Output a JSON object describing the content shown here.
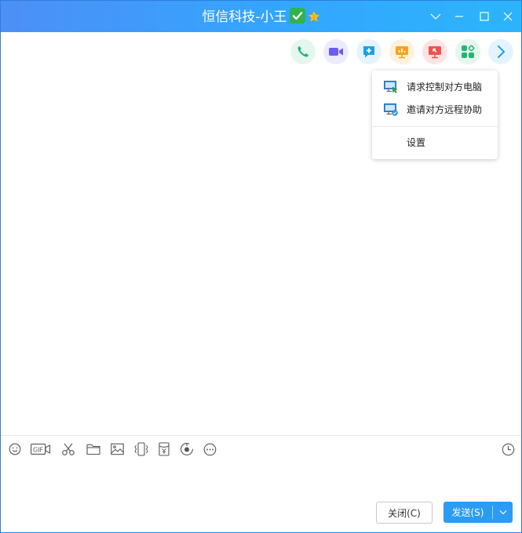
{
  "window": {
    "title": "恒信科技-小王"
  },
  "toolbar": {
    "icons": [
      "phone-icon",
      "video-call-icon",
      "new-chat-icon",
      "presentation-icon",
      "remote-desktop-icon",
      "apps-icon",
      "more-arrow-icon"
    ]
  },
  "dropdown": {
    "items": [
      {
        "label": "请求控制对方电脑"
      },
      {
        "label": "邀请对方远程协助"
      },
      {
        "label": "设置"
      }
    ]
  },
  "input_toolbar": {
    "gif_label": "GIF"
  },
  "buttons": {
    "close_label": "关闭(C)",
    "send_label": "发送(S)"
  },
  "colors": {
    "titlebar_start": "#4d8ff6",
    "titlebar_end": "#2cb4fb",
    "send_button": "#2a9cf4"
  }
}
